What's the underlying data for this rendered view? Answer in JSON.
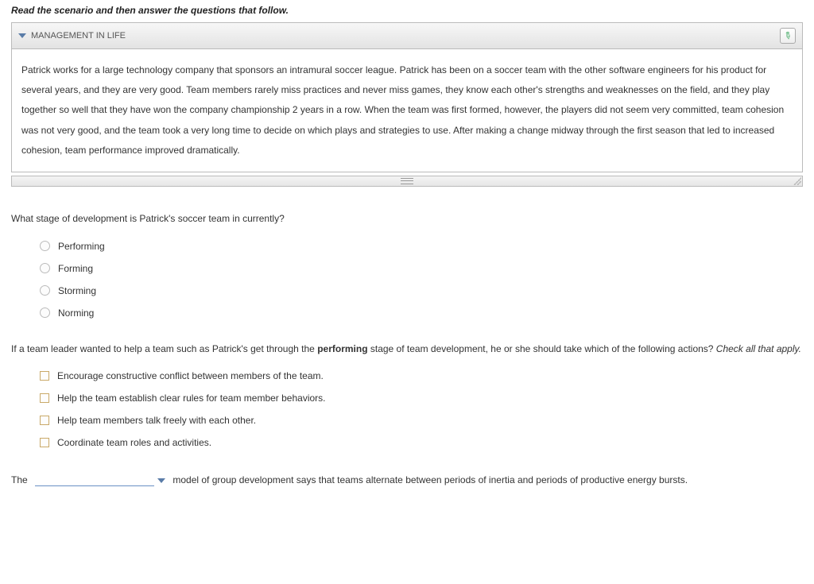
{
  "instructions": "Read the scenario and then answer the questions that follow.",
  "panel": {
    "title": "MANAGEMENT IN LIFE",
    "body": "Patrick works for a large technology company that sponsors an intramural soccer league. Patrick has been on a soccer team with the other software engineers for his product for several years, and they are very good. Team members rarely miss practices and never miss games, they know each other's strengths and weaknesses on the field, and they play together so well that they have won the company championship 2 years in a row. When the team was first formed, however, the players did not seem very committed, team cohesion was not very good, and the team took a very long time to decide on which plays and strategies to use. After making a change midway through the first season that led to increased cohesion, team performance improved dramatically."
  },
  "q1": {
    "text": "What stage of development is Patrick's soccer team in currently?",
    "options": [
      "Performing",
      "Forming",
      "Storming",
      "Norming"
    ]
  },
  "q2": {
    "pre": "If a team leader wanted to help a team such as Patrick's get through the ",
    "bold": "performing",
    "post": " stage of team development, he or she should take which of the following actions?  ",
    "hint": "Check all that apply.",
    "options": [
      "Encourage constructive conflict between members of the team.",
      "Help the team establish clear rules for team member behaviors.",
      "Help team members talk freely with each other.",
      "Coordinate team roles and activities."
    ]
  },
  "q3": {
    "pre": "The ",
    "post": " model of group development says that teams alternate between periods of inertia and periods of productive energy bursts."
  }
}
